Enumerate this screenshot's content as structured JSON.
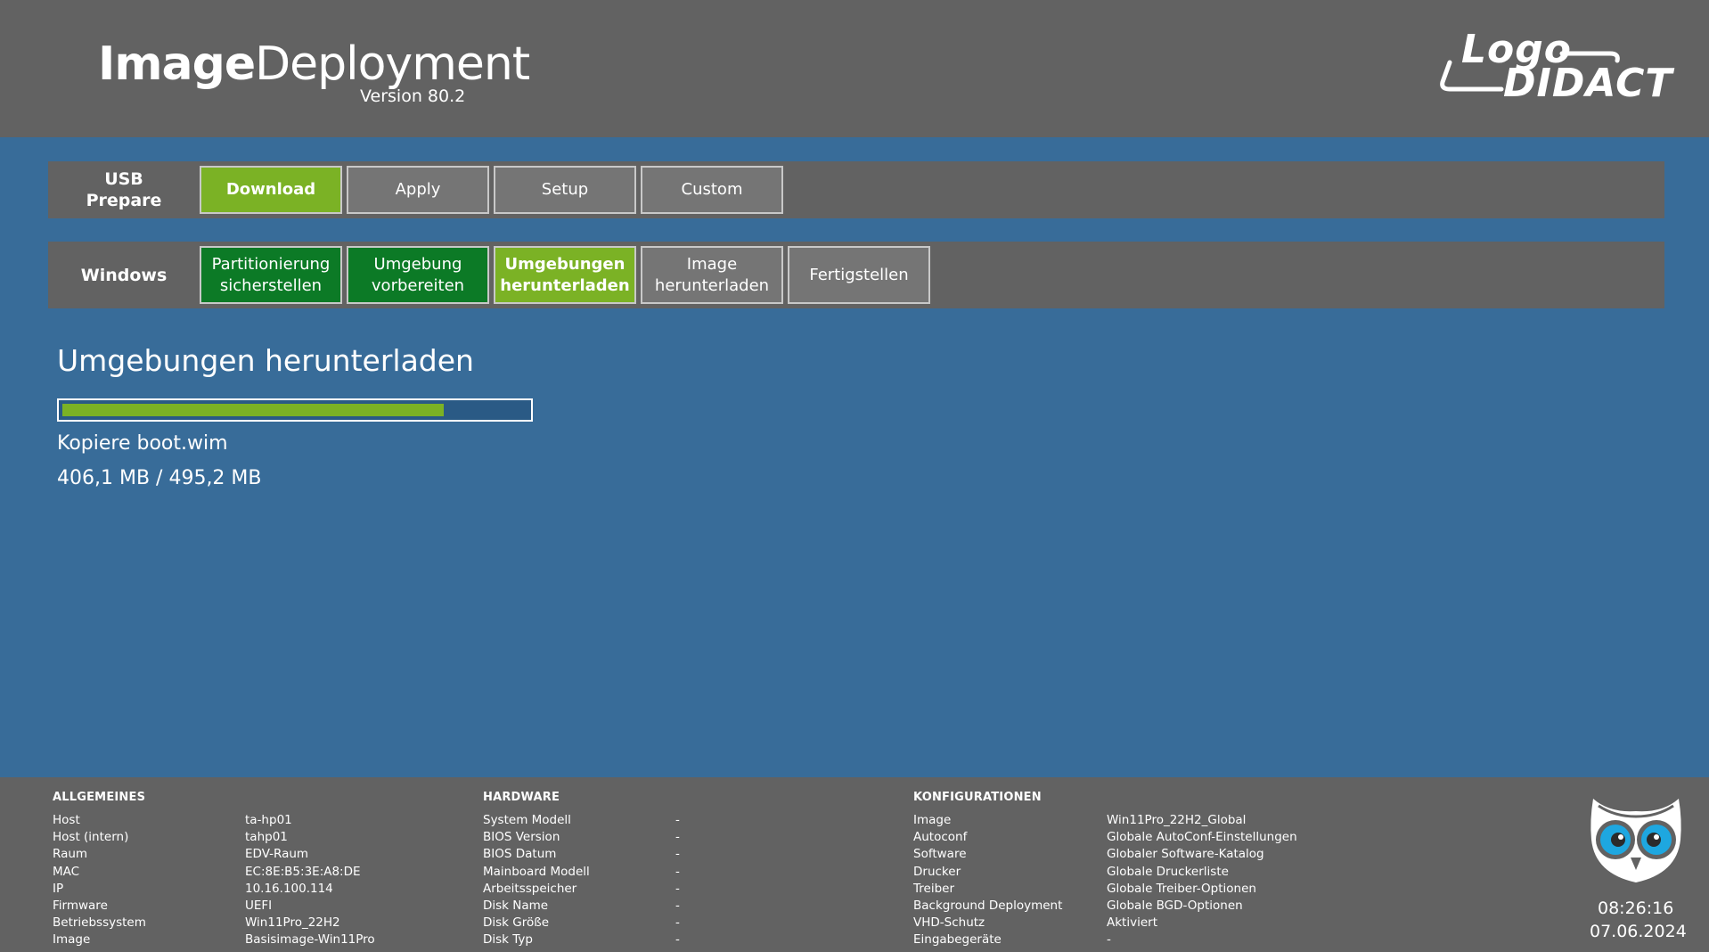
{
  "header": {
    "title_bold": "Image",
    "title_light": "Deployment",
    "version": "Version 80.2",
    "logo_line1": "Logo",
    "logo_line2": "DIDACT"
  },
  "nav": {
    "usb": {
      "label_line1": "USB",
      "label_line2": "Prepare",
      "buttons": [
        {
          "label": "Download",
          "state": "active"
        },
        {
          "label": "Apply",
          "state": "idle"
        },
        {
          "label": "Setup",
          "state": "idle"
        },
        {
          "label": "Custom",
          "state": "idle"
        }
      ]
    },
    "windows": {
      "label": "Windows",
      "buttons": [
        {
          "line1": "Partitionierung",
          "line2": "sicherstellen",
          "state": "done"
        },
        {
          "line1": "Umgebung",
          "line2": "vorbereiten",
          "state": "done"
        },
        {
          "line1": "Umgebungen",
          "line2": "herunterladen",
          "state": "active"
        },
        {
          "line1": "Image",
          "line2": "herunterladen",
          "state": "idle"
        },
        {
          "line1": "Fertigstellen",
          "line2": "",
          "state": "idle"
        }
      ]
    }
  },
  "status": {
    "title": "Umgebungen herunterladen",
    "progress_fraction": 0.82,
    "file": "Kopiere boot.wim",
    "size": "406,1 MB / 495,2 MB"
  },
  "footer": {
    "allgemeines": {
      "heading": "ALLGEMEINES",
      "rows": [
        {
          "k": "Host",
          "v": "ta-hp01"
        },
        {
          "k": "Host (intern)",
          "v": "tahp01"
        },
        {
          "k": "Raum",
          "v": "EDV-Raum"
        },
        {
          "k": "MAC",
          "v": "EC:8E:B5:3E:A8:DE"
        },
        {
          "k": "IP",
          "v": "10.16.100.114"
        },
        {
          "k": "Firmware",
          "v": "UEFI"
        },
        {
          "k": "Betriebssystem",
          "v": "Win11Pro_22H2"
        },
        {
          "k": "Image",
          "v": "Basisimage-Win11Pro"
        }
      ]
    },
    "hardware": {
      "heading": "HARDWARE",
      "rows": [
        {
          "k": "System Modell",
          "v": "-"
        },
        {
          "k": "BIOS Version",
          "v": "-"
        },
        {
          "k": "BIOS Datum",
          "v": "-"
        },
        {
          "k": "Mainboard Modell",
          "v": "-"
        },
        {
          "k": "Arbeitsspeicher",
          "v": "-"
        },
        {
          "k": "Disk Name",
          "v": "-"
        },
        {
          "k": "Disk Größe",
          "v": "-"
        },
        {
          "k": "Disk Typ",
          "v": "-"
        }
      ]
    },
    "konfigurationen": {
      "heading": "KONFIGURATIONEN",
      "rows": [
        {
          "k": "Image",
          "v": "Win11Pro_22H2_Global"
        },
        {
          "k": "Autoconf",
          "v": "Globale AutoConf-Einstellungen"
        },
        {
          "k": "Software",
          "v": "Globaler Software-Katalog"
        },
        {
          "k": "Drucker",
          "v": "Globale Druckerliste"
        },
        {
          "k": "Treiber",
          "v": "Globale Treiber-Optionen"
        },
        {
          "k": "Background Deployment",
          "v": "Globale BGD-Optionen"
        },
        {
          "k": "VHD-Schutz",
          "v": "Aktiviert"
        },
        {
          "k": "Eingabegeräte",
          "v": "-"
        }
      ]
    },
    "clock": {
      "time": "08:26:16",
      "date": "07.06.2024"
    }
  },
  "colors": {
    "background": "#386c99",
    "panel": "#626262",
    "active": "#7bb225",
    "done": "#0c7a26",
    "idle": "#757575"
  }
}
